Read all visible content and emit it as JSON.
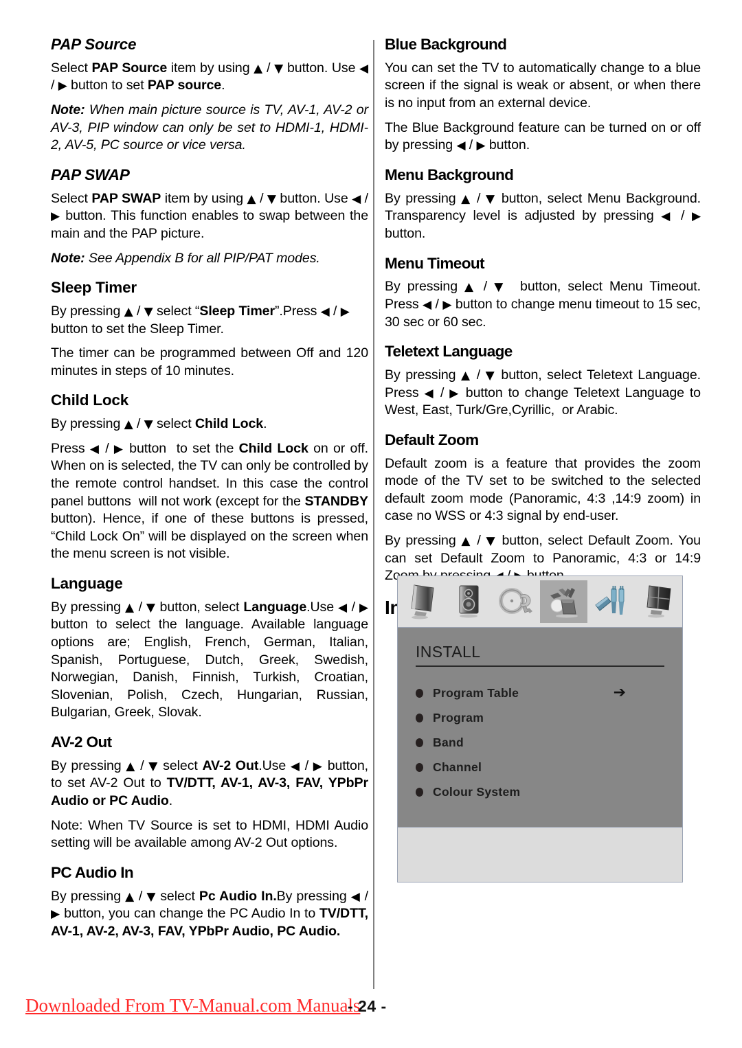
{
  "page": {
    "number": "- 24 -",
    "watermark": "Downloaded From TV-Manual.com Manuals"
  },
  "left_column": {
    "sections": [
      {
        "id": "pap-source",
        "heading": "PAP Source",
        "paragraphs": [
          "Select PAP Source item by using ▲ / ▼ button. Use ◀ / ▶ button to set PAP source.",
          "Note: When main picture source is TV, AV-1, AV-2 or AV-3, PIP window can only be set to HDMI-1, HDMI-2, AV-5, PC source or vice versa."
        ]
      },
      {
        "id": "pap-swap",
        "heading": "PAP SWAP",
        "paragraphs": [
          "Select PAP SWAP item by using ▲ / ▼ button. Use ◀ / ▶ button. This function enables to swap between the main and the PAP picture.",
          "Note: See Appendix B for all PIP/PAT modes."
        ]
      },
      {
        "id": "sleep-timer",
        "heading": "Sleep Timer",
        "paragraphs": [
          "By pressing ▲ / ▼ select “Sleep Timer”.Press ◀ / ▶ button to set the Sleep Timer.",
          "The timer can be programmed between Off and 120 minutes in steps of 10 minutes."
        ]
      },
      {
        "id": "child-lock",
        "heading": "Child Lock",
        "paragraphs": [
          "By pressing ▲ / ▼ select Child Lock.",
          "Press ◀ / ▶ button to set the Child Lock on or off. When on is selected, the TV can only be controlled by the remote control handset. In this case the control panel buttons will not work (except for the STANDBY button). Hence, if one of these buttons is pressed, “Child Lock On” will be displayed on the screen when the menu screen is not visible."
        ]
      },
      {
        "id": "language",
        "heading": "Language",
        "paragraphs": [
          "By pressing ▲ / ▼ button, select Language.Use ◀ / ▶ button to select the language. Available language options are; English, French, German, Italian, Spanish, Portuguese, Dutch, Greek, Swedish, Norwegian, Danish, Finnish, Turkish, Croatian, Slovenian, Polish, Czech, Hungarian, Russian, Bulgarian, Greek, Slovak."
        ]
      },
      {
        "id": "av-2-out",
        "heading": "AV-2 Out",
        "paragraphs": [
          "By pressing ▲ / ▼ select AV-2 Out.Use ◀ / ▶ button, to set AV-2 Out to TV/DTT, AV-1, AV-3, FAV, YPbPr Audio or PC Audio.",
          "Note: When TV Source is set to HDMI, HDMI Audio setting will be available among AV-2 Out options."
        ]
      },
      {
        "id": "pc-audio-in",
        "heading": "PC Audio In",
        "paragraphs": [
          "By pressing ▲ / ▼ select Pc Audio In.By pressing ◀ / ▶ button, you can change the PC Audio In to TV/DTT, AV-1, AV-2, AV-3, FAV, YPbPr Audio, PC Audio."
        ]
      }
    ]
  },
  "right_column": {
    "sections": [
      {
        "id": "blue-background",
        "heading": "Blue Background",
        "paragraphs": [
          "You can set the TV to automatically change to a blue screen if the signal is weak or absent, or when there is no input from an external device.",
          "The Blue Background feature can be turned on or off by pressing ◀ / ▶ button."
        ]
      },
      {
        "id": "menu-background",
        "heading": "Menu Background",
        "paragraphs": [
          "By pressing ▲ / ▼ button, select Menu Background. Transparency level is adjusted by pressing ◀ / ▶ button."
        ]
      },
      {
        "id": "menu-timeout",
        "heading": "Menu Timeout",
        "paragraphs": [
          "By pressing ▲ / ▼ button, select Menu Timeout. Press ◀ / ▶ button to change menu timeout to 15 sec, 30 sec or 60 sec."
        ]
      },
      {
        "id": "teletext-language",
        "heading": "Teletext Language",
        "paragraphs": [
          "By pressing ▲ / ▼ button, select Teletext Language. Press ◀ / ▶ button to change Teletext Language to West, East, Turk/Gre,Cyrillic, or Arabic."
        ]
      },
      {
        "id": "default-zoom",
        "heading": "Default Zoom",
        "paragraphs": [
          "Default zoom is a feature that provides the zoom mode of the TV set to be switched to the selected default zoom mode (Panoramic, 4:3 ,14:9 zoom) in case no WSS or 4:3 signal by end-user.",
          "By pressing ▲ / ▼ button, select Default Zoom. You can set Default Zoom to Panoramic, 4:3 or 14:9 Zoom by pressing ◀ / ▶ button."
        ]
      }
    ],
    "install_menu_heading": "Install Menu"
  },
  "osd": {
    "title": "INSTALL",
    "selected_icon_index": 3,
    "icons": [
      "picture-settings-icon",
      "sound-settings-icon",
      "feature-settings-icon",
      "install-settings-icon",
      "source-settings-icon",
      "pc-settings-icon"
    ],
    "items": [
      {
        "label": "Program Table",
        "arrow": "➔"
      },
      {
        "label": "Program",
        "arrow": ""
      },
      {
        "label": "Band",
        "arrow": ""
      },
      {
        "label": "Channel",
        "arrow": ""
      },
      {
        "label": "Colour System",
        "arrow": ""
      }
    ],
    "colors": {
      "panel_bg": "#878787",
      "frame_bg": "#dcdcdc",
      "border": "#9aa3b4",
      "selected_icon_bg": "#a8a8a8"
    }
  }
}
